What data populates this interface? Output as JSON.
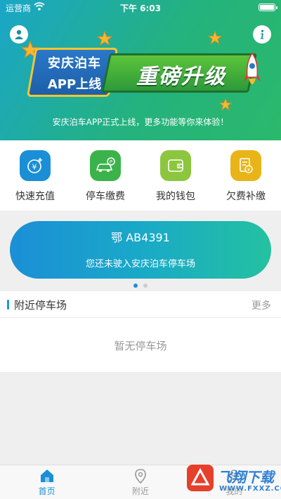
{
  "status_bar": {
    "carrier": "运营商",
    "time": "下午 6:03"
  },
  "hero": {
    "badge_line1": "安庆泊车",
    "badge_line2": "APP上线",
    "headline": "重磅升级",
    "subtitle": "安庆泊车APP正式上线，更多功能等你来体验！"
  },
  "actions": [
    {
      "label": "快速充值",
      "icon": "recharge-icon",
      "color": "#1b8fd6"
    },
    {
      "label": "停车缴费",
      "icon": "parking-payment-icon",
      "color": "#3cb34a"
    },
    {
      "label": "我的钱包",
      "icon": "wallet-icon",
      "color": "#8cc63f"
    },
    {
      "label": "欠费补缴",
      "icon": "arrears-icon",
      "color": "#e8b418"
    }
  ],
  "car_card": {
    "plate": "鄂 AB4391",
    "message": "您还未驶入安庆泊车停车场"
  },
  "carousel": {
    "count": 2,
    "active": 0
  },
  "nearby": {
    "title": "附近停车场",
    "more": "更多",
    "empty": "暂无停车场"
  },
  "tabs": [
    {
      "label": "首页",
      "icon": "home-icon",
      "active": true
    },
    {
      "label": "附近",
      "icon": "location-pin-icon",
      "active": false
    },
    {
      "label": "我的",
      "icon": "profile-icon",
      "active": false
    }
  ],
  "watermark": {
    "text": "飞翔下载",
    "url": "WWW.FXXZ.COM"
  }
}
